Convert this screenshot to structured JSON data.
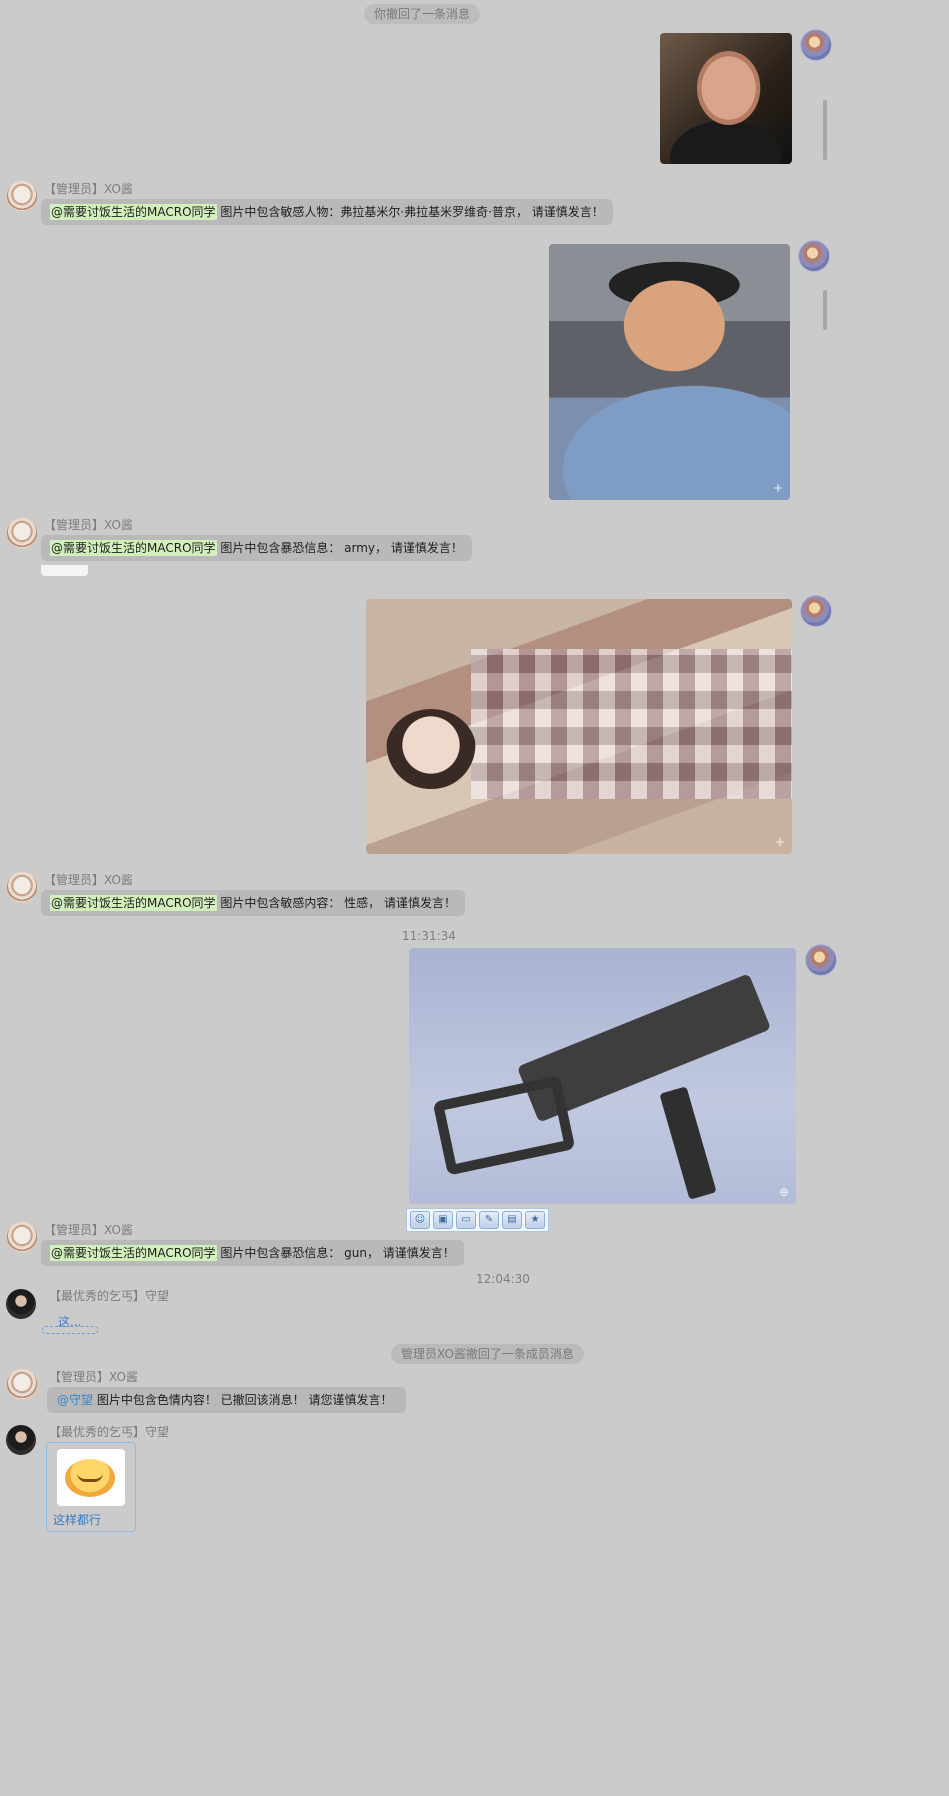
{
  "system": {
    "recall_self": "你撤回了一条消息",
    "recall_admin": "管理员XO酱撤回了一条成员消息"
  },
  "timestamps": [
    "11:31:34",
    "12:04:30"
  ],
  "admin_name": "【管理员】XO酱",
  "member_name": "【最优秀的乞丐】守望",
  "mention": "@需要讨饭生活的MACRO同学",
  "mention_shouwang": "@守望",
  "warnings": [
    "图片中包含敏感人物：弗拉基米尔·弗拉基米罗维奇·普京，   请谨慎发言！",
    "图片中包含暴恐信息： army，   请谨慎发言！",
    "图片中包含敏感内容： 性感，   请谨慎发言！",
    "图片中包含暴恐信息： gun，   请谨慎发言！",
    "图片中包含色情内容！ 已撤回该消息！ 请您谨慎发言！"
  ],
  "member_messages": [
    "这...",
    "这样都行"
  ],
  "toolbar_icons": [
    "emoji-icon",
    "save-icon",
    "screen-icon",
    "edit-icon",
    "folder-icon",
    "bookmark-icon"
  ],
  "colors": {
    "background": "#cbcbcb",
    "bubble": "#b9b9b9",
    "mention_highlight": "#d2f0bb",
    "link_blue": "#3a86c9"
  }
}
